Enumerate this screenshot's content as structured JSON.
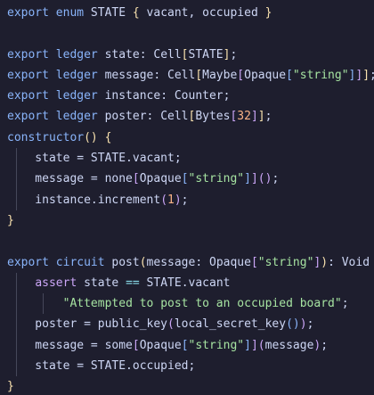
{
  "code": {
    "lines": [
      {
        "tokens": [
          {
            "t": "export enum ",
            "c": "kw"
          },
          {
            "t": "STATE ",
            "c": "ident"
          },
          {
            "t": "{",
            "c": "br1"
          },
          {
            "t": " vacant, occupied ",
            "c": "ident"
          },
          {
            "t": "}",
            "c": "br1"
          }
        ]
      },
      {
        "tokens": []
      },
      {
        "tokens": [
          {
            "t": "export ledger ",
            "c": "kw"
          },
          {
            "t": "state: Cell",
            "c": "ident"
          },
          {
            "t": "[",
            "c": "br1"
          },
          {
            "t": "STATE",
            "c": "ident"
          },
          {
            "t": "]",
            "c": "br1"
          },
          {
            "t": ";",
            "c": "ident"
          }
        ]
      },
      {
        "tokens": [
          {
            "t": "export ledger ",
            "c": "kw"
          },
          {
            "t": "message: Cell",
            "c": "ident"
          },
          {
            "t": "[",
            "c": "br1"
          },
          {
            "t": "Maybe",
            "c": "ident"
          },
          {
            "t": "[",
            "c": "br2"
          },
          {
            "t": "Opaque",
            "c": "ident"
          },
          {
            "t": "[",
            "c": "br3"
          },
          {
            "t": "\"string\"",
            "c": "str"
          },
          {
            "t": "]",
            "c": "br3"
          },
          {
            "t": "]",
            "c": "br2"
          },
          {
            "t": "]",
            "c": "br1"
          },
          {
            "t": ";",
            "c": "ident"
          }
        ]
      },
      {
        "tokens": [
          {
            "t": "export ledger ",
            "c": "kw"
          },
          {
            "t": "instance: Counter;",
            "c": "ident"
          }
        ]
      },
      {
        "tokens": [
          {
            "t": "export ledger ",
            "c": "kw"
          },
          {
            "t": "poster: Cell",
            "c": "ident"
          },
          {
            "t": "[",
            "c": "br1"
          },
          {
            "t": "Bytes",
            "c": "ident"
          },
          {
            "t": "[",
            "c": "br2"
          },
          {
            "t": "32",
            "c": "num"
          },
          {
            "t": "]",
            "c": "br2"
          },
          {
            "t": "]",
            "c": "br1"
          },
          {
            "t": ";",
            "c": "ident"
          }
        ]
      },
      {
        "tokens": [
          {
            "t": "constructor",
            "c": "kw"
          },
          {
            "t": "()",
            "c": "br1"
          },
          {
            "t": " ",
            "c": "ident"
          },
          {
            "t": "{",
            "c": "br1"
          }
        ]
      },
      {
        "guides": 1,
        "tokens": [
          {
            "t": "    state = STATE.vacant;",
            "c": "ident"
          }
        ]
      },
      {
        "guides": 1,
        "tokens": [
          {
            "t": "    message = none",
            "c": "ident"
          },
          {
            "t": "[",
            "c": "br2"
          },
          {
            "t": "Opaque",
            "c": "ident"
          },
          {
            "t": "[",
            "c": "br3"
          },
          {
            "t": "\"string\"",
            "c": "str"
          },
          {
            "t": "]",
            "c": "br3"
          },
          {
            "t": "]",
            "c": "br2"
          },
          {
            "t": "()",
            "c": "br2"
          },
          {
            "t": ";",
            "c": "ident"
          }
        ]
      },
      {
        "guides": 1,
        "tokens": [
          {
            "t": "    instance.increment",
            "c": "ident"
          },
          {
            "t": "(",
            "c": "br2"
          },
          {
            "t": "1",
            "c": "num"
          },
          {
            "t": ")",
            "c": "br2"
          },
          {
            "t": ";",
            "c": "ident"
          }
        ]
      },
      {
        "tokens": [
          {
            "t": "}",
            "c": "br1"
          }
        ]
      },
      {
        "tokens": []
      },
      {
        "tokens": [
          {
            "t": "export circuit ",
            "c": "kw"
          },
          {
            "t": "post",
            "c": "ident"
          },
          {
            "t": "(",
            "c": "br1"
          },
          {
            "t": "message: Opaque",
            "c": "ident"
          },
          {
            "t": "[",
            "c": "br2"
          },
          {
            "t": "\"string\"",
            "c": "str"
          },
          {
            "t": "]",
            "c": "br2"
          },
          {
            "t": ")",
            "c": "br1"
          },
          {
            "t": ": Void ",
            "c": "ident"
          },
          {
            "t": "{",
            "c": "br1"
          }
        ]
      },
      {
        "guides": 1,
        "tokens": [
          {
            "t": "    ",
            "c": "ident"
          },
          {
            "t": "assert",
            "c": "assert"
          },
          {
            "t": " state ",
            "c": "ident"
          },
          {
            "t": "==",
            "c": "op"
          },
          {
            "t": " STATE.vacant",
            "c": "ident"
          }
        ]
      },
      {
        "guides": 2,
        "tokens": [
          {
            "t": "        ",
            "c": "ident"
          },
          {
            "t": "\"Attempted to post to an occupied board\"",
            "c": "str"
          },
          {
            "t": ";",
            "c": "ident"
          }
        ]
      },
      {
        "guides": 1,
        "tokens": [
          {
            "t": "    poster = public_key",
            "c": "ident"
          },
          {
            "t": "(",
            "c": "br2"
          },
          {
            "t": "local_secret_key",
            "c": "ident"
          },
          {
            "t": "()",
            "c": "br3"
          },
          {
            "t": ")",
            "c": "br2"
          },
          {
            "t": ";",
            "c": "ident"
          }
        ]
      },
      {
        "guides": 1,
        "tokens": [
          {
            "t": "    message = some",
            "c": "ident"
          },
          {
            "t": "[",
            "c": "br2"
          },
          {
            "t": "Opaque",
            "c": "ident"
          },
          {
            "t": "[",
            "c": "br3"
          },
          {
            "t": "\"string\"",
            "c": "str"
          },
          {
            "t": "]",
            "c": "br3"
          },
          {
            "t": "]",
            "c": "br2"
          },
          {
            "t": "(",
            "c": "br2"
          },
          {
            "t": "message",
            "c": "ident"
          },
          {
            "t": ")",
            "c": "br2"
          },
          {
            "t": ";",
            "c": "ident"
          }
        ]
      },
      {
        "guides": 1,
        "tokens": [
          {
            "t": "    state = STATE.occupied;",
            "c": "ident"
          }
        ]
      },
      {
        "tokens": [
          {
            "t": "}",
            "c": "br1"
          }
        ]
      }
    ]
  },
  "colors": {
    "background": "#1e1e2e",
    "keyword": "#89b4fa",
    "string": "#a6e3a1",
    "number": "#fab387",
    "bracket_level1": "#f9e2af",
    "bracket_level2": "#cba6f7",
    "bracket_level3": "#89b4fa",
    "assert_keyword": "#cba6f7",
    "text": "#cdd6f4"
  }
}
